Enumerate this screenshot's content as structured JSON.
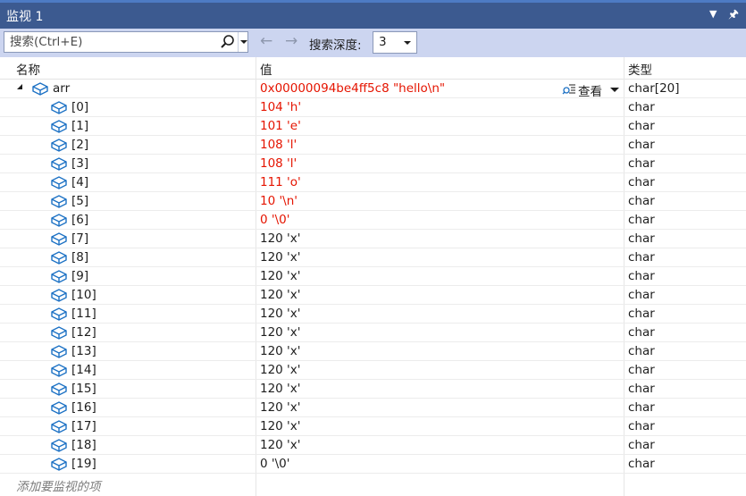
{
  "window": {
    "title": "监视 1"
  },
  "toolbar": {
    "search_placeholder": "搜索(Ctrl+E)",
    "depth_label": "搜索深度:",
    "depth_value": "3"
  },
  "columns": {
    "name": "名称",
    "value": "值",
    "type": "类型"
  },
  "root": {
    "name": "arr",
    "value": "0x00000094be4ff5c8 \"hello\\n\"",
    "view_label": "查看",
    "type": "char[20]"
  },
  "items": [
    {
      "name": "[0]",
      "value": "104 'h'",
      "type": "char",
      "changed": true
    },
    {
      "name": "[1]",
      "value": "101 'e'",
      "type": "char",
      "changed": true
    },
    {
      "name": "[2]",
      "value": "108 'l'",
      "type": "char",
      "changed": true
    },
    {
      "name": "[3]",
      "value": "108 'l'",
      "type": "char",
      "changed": true
    },
    {
      "name": "[4]",
      "value": "111 'o'",
      "type": "char",
      "changed": true
    },
    {
      "name": "[5]",
      "value": "10 '\\n'",
      "type": "char",
      "changed": true
    },
    {
      "name": "[6]",
      "value": "0 '\\0'",
      "type": "char",
      "changed": true
    },
    {
      "name": "[7]",
      "value": "120 'x'",
      "type": "char",
      "changed": false
    },
    {
      "name": "[8]",
      "value": "120 'x'",
      "type": "char",
      "changed": false
    },
    {
      "name": "[9]",
      "value": "120 'x'",
      "type": "char",
      "changed": false
    },
    {
      "name": "[10]",
      "value": "120 'x'",
      "type": "char",
      "changed": false
    },
    {
      "name": "[11]",
      "value": "120 'x'",
      "type": "char",
      "changed": false
    },
    {
      "name": "[12]",
      "value": "120 'x'",
      "type": "char",
      "changed": false
    },
    {
      "name": "[13]",
      "value": "120 'x'",
      "type": "char",
      "changed": false
    },
    {
      "name": "[14]",
      "value": "120 'x'",
      "type": "char",
      "changed": false
    },
    {
      "name": "[15]",
      "value": "120 'x'",
      "type": "char",
      "changed": false
    },
    {
      "name": "[16]",
      "value": "120 'x'",
      "type": "char",
      "changed": false
    },
    {
      "name": "[17]",
      "value": "120 'x'",
      "type": "char",
      "changed": false
    },
    {
      "name": "[18]",
      "value": "120 'x'",
      "type": "char",
      "changed": false
    },
    {
      "name": "[19]",
      "value": "0 '\\0'",
      "type": "char",
      "changed": false
    }
  ],
  "add_watch_placeholder": "添加要监视的项",
  "colors": {
    "changed_value": "#e51400",
    "title_bar": "#3c5a90",
    "toolbar": "#ccd5f0"
  }
}
